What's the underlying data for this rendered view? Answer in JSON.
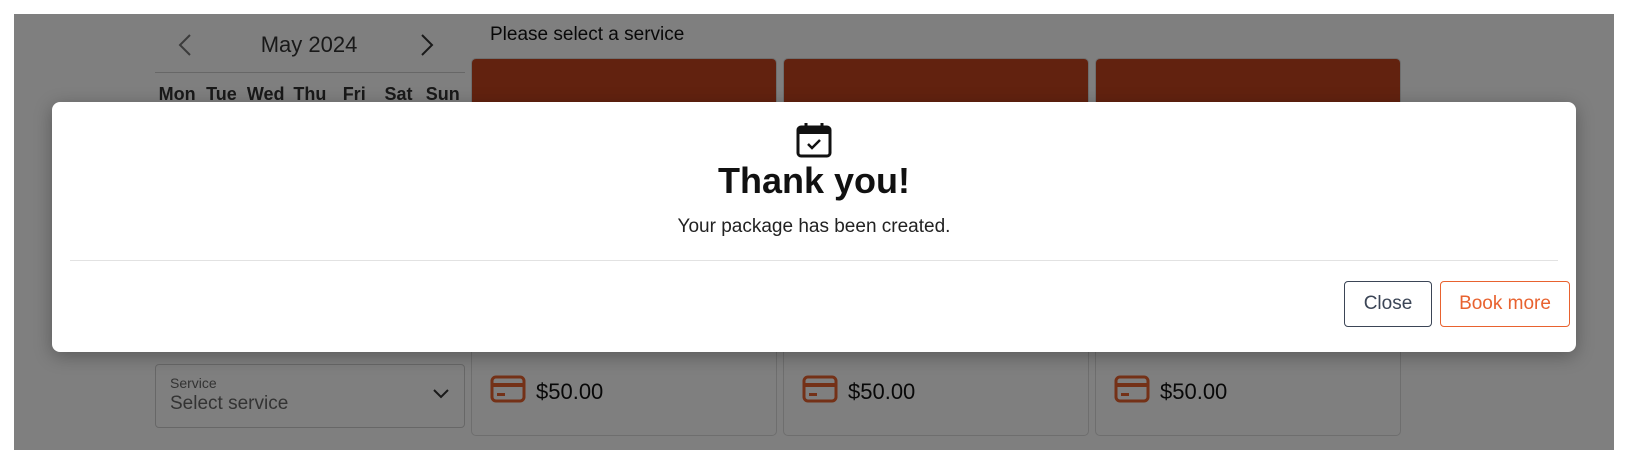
{
  "calendar": {
    "month_label": "May 2024",
    "prev_icon": "chevron-left-icon",
    "next_icon": "chevron-right-icon",
    "weekdays": [
      "Mon",
      "Tue",
      "Wed",
      "Thu",
      "Fri",
      "Sat",
      "Sun"
    ]
  },
  "services": {
    "title": "Please select a service",
    "cards": [
      {
        "price": "$50.00",
        "icon": "credit-card-icon"
      },
      {
        "price": "$50.00",
        "icon": "credit-card-icon"
      },
      {
        "price": "$50.00",
        "icon": "credit-card-icon"
      }
    ]
  },
  "service_select": {
    "label": "Service",
    "placeholder": "Select service",
    "icon": "chevron-down-icon"
  },
  "modal": {
    "icon": "calendar-check-icon",
    "title": "Thank you!",
    "message": "Your package has been created.",
    "close_label": "Close",
    "book_more_label": "Book more"
  },
  "colors": {
    "accent": "#e8622f",
    "card_header": "#c4441f",
    "close_border": "#3b4556",
    "overlay": "rgba(0,0,0,0.5)"
  }
}
